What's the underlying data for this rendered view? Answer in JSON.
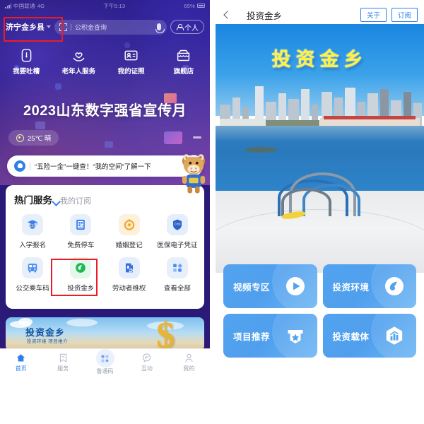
{
  "left_phone": {
    "statusbar": {
      "carrier": "中国联通",
      "network": "4G",
      "time": "下午5:13",
      "battery": "65%"
    },
    "search": {
      "city": "济宁金乡县",
      "placeholder": "公积金查询",
      "scan_icon": "scan-icon",
      "mic_icon": "microphone-icon",
      "person_label": "个人"
    },
    "quick_actions": [
      {
        "label": "我要吐槽",
        "icon": "feedback-icon"
      },
      {
        "label": "老年人服务",
        "icon": "elderly-care-icon"
      },
      {
        "label": "我的证照",
        "icon": "id-card-icon"
      },
      {
        "label": "旗舰店",
        "icon": "store-icon"
      }
    ],
    "banner_title": "2023山东数字强省宣传月",
    "weather": {
      "icon": "sun-icon",
      "text": "25℃ 晴"
    },
    "notice": {
      "icon": "bell-icon",
      "text": "“五险一金”一键查！“我的空间”了解一下"
    },
    "services_card": {
      "title": "热门服务",
      "subtitle": "我的订阅",
      "items": [
        {
          "label": "入学报名",
          "icon": "graduation-cap-icon",
          "bg": "#e7effb",
          "fg": "#4a8cf0"
        },
        {
          "label": "免费停车",
          "icon": "qr-parking-icon",
          "bg": "#e7effb",
          "fg": "#3a7ff0"
        },
        {
          "label": "婚姻登记",
          "icon": "marriage-ring-icon",
          "bg": "#fdf0dc",
          "fg": "#f0a82c"
        },
        {
          "label": "医保电子凭证",
          "icon": "medical-shield-icon",
          "bg": "#e4eefc",
          "fg": "#2f62c8"
        },
        {
          "label": "公交乘车码",
          "icon": "bus-icon",
          "bg": "#e7effb",
          "fg": "#4a8cf0"
        },
        {
          "label": "投资金乡",
          "icon": "leaf-swoosh-icon",
          "bg": "#e3f7ea",
          "fg": "#1db954"
        },
        {
          "label": "劳动者维权",
          "icon": "labor-rights-icon",
          "bg": "#e4eefc",
          "fg": "#3a6fd8"
        },
        {
          "label": "查看全部",
          "icon": "grid-more-icon",
          "bg": "#e7effb",
          "fg": "#4a8cf0"
        }
      ]
    },
    "ad_banner": {
      "title": "投资金乡",
      "subtitle": "投资环境  项目推介",
      "symbol": "$"
    },
    "tabbar": [
      {
        "label": "首页",
        "icon": "home-icon",
        "active": true
      },
      {
        "label": "服务",
        "icon": "service-icon",
        "active": false
      },
      {
        "label": "鲁通码",
        "icon": "qr-code-icon",
        "active": false
      },
      {
        "label": "互动",
        "icon": "chat-icon",
        "active": false
      },
      {
        "label": "我的",
        "icon": "user-icon",
        "active": false
      }
    ]
  },
  "right_phone": {
    "header": {
      "back_icon": "back-chevron-icon",
      "title": "投资金乡",
      "about_label": "关于",
      "subscribe_label": "订阅"
    },
    "hero_title": "投资金乡",
    "cards": [
      {
        "label": "视频专区",
        "icon": "play-circle-icon"
      },
      {
        "label": "投资环境",
        "icon": "leaf-swoosh-icon"
      },
      {
        "label": "项目推荐",
        "icon": "badge-star-icon"
      },
      {
        "label": "投资载体",
        "icon": "hex-chart-icon"
      }
    ]
  },
  "annotations": {
    "highlight_color": "#ec1c24",
    "boxes": [
      {
        "name": "city-selector-highlight",
        "target": "济宁金乡县"
      },
      {
        "name": "invest-jinxiang-highlight",
        "target": "投资金乡"
      }
    ]
  }
}
